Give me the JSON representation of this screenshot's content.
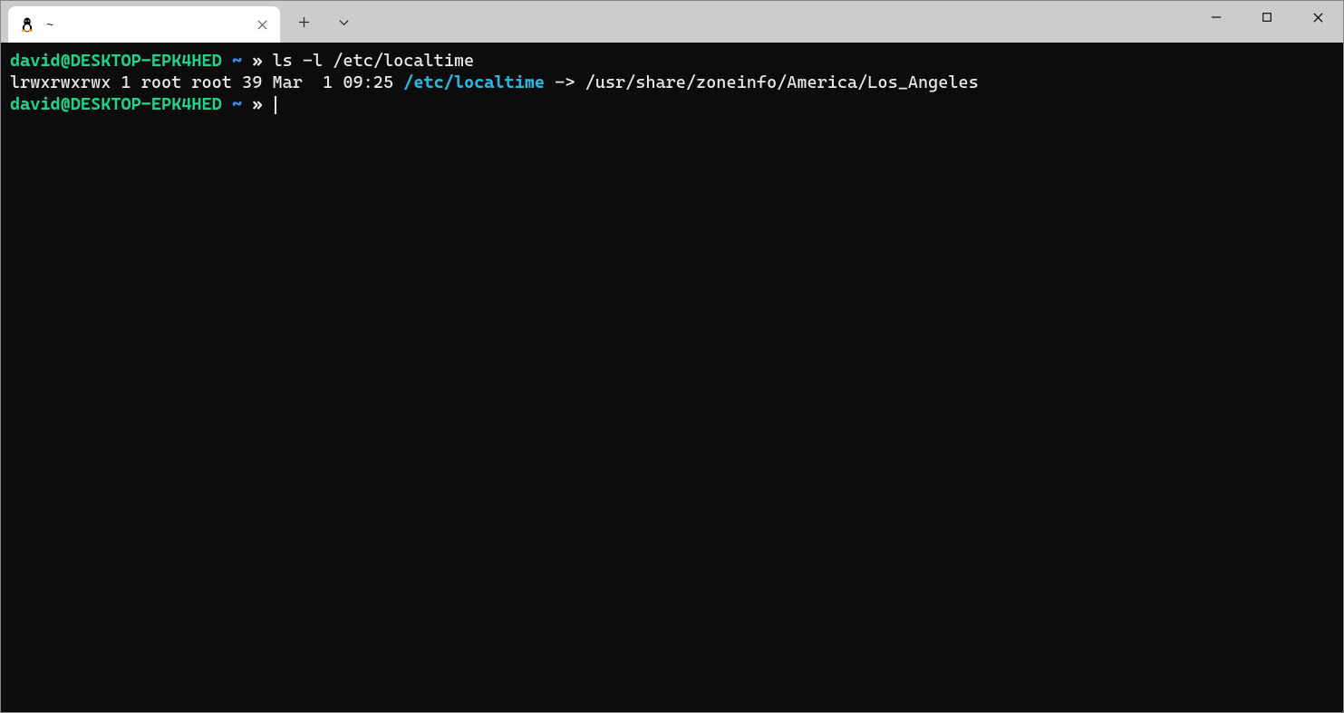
{
  "tab": {
    "title": "~"
  },
  "terminal": {
    "lines": [
      {
        "user": "david@DESKTOP-EPK4HED",
        "path": "~",
        "sep": "»",
        "command": "ls -l /etc/localtime"
      },
      {
        "perm": "lrwxrwxrwx 1 root root 39 Mar  1 09:25 ",
        "link": "/etc/localtime",
        "arrow": " -> ",
        "target": "/usr/share/zoneinfo/America/Los_Angeles"
      },
      {
        "user": "david@DESKTOP-EPK4HED",
        "path": "~",
        "sep": "»",
        "command": ""
      }
    ]
  }
}
